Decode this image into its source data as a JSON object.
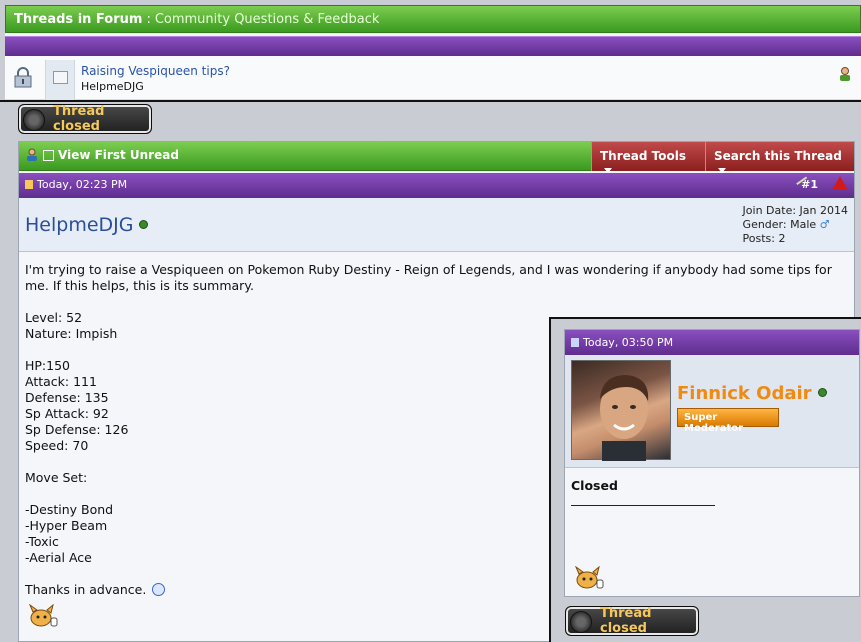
{
  "forum": {
    "label": "Threads in Forum",
    "separator": ":",
    "name": "Community Questions & Feedback"
  },
  "thread": {
    "title": "Raising Vespiqueen tips?",
    "author": "HelpmeDJG"
  },
  "status_button": "Thread closed",
  "toolbar": {
    "view_first_unread": "View First Unread",
    "thread_tools": "Thread Tools",
    "search_thread": "Search this Thread"
  },
  "post": {
    "timestamp": "Today, 02:23 PM",
    "number": "#1",
    "username": "HelpmeDJG",
    "join_date": "Join Date: Jan 2014",
    "gender": "Gender: Male",
    "posts": "Posts: 2",
    "body": "I'm trying to raise a Vespiqueen on Pokemon Ruby Destiny - Reign of Legends, and I was wondering if anybody had some tips for me. If this helps, this is its summary.\n\nLevel: 52\nNature: Impish\n\nHP:150\nAttack: 111\nDefense: 135\nSp Attack: 92\nSp Defense: 126\nSpeed: 70\n\nMove Set:\n\n-Destiny Bond\n-Hyper Beam\n-Toxic\n-Aerial Ace\n\n",
    "closing": "Thanks in advance."
  },
  "mod_post": {
    "timestamp": "Today, 03:50 PM",
    "username": "Finnick Odair",
    "rank": "Super Moderator",
    "body": "Closed"
  },
  "colors": {
    "green": "#3a9a20",
    "purple": "#5e2d8e",
    "red": "#8b1f1f",
    "mod_orange": "#f08a10"
  }
}
